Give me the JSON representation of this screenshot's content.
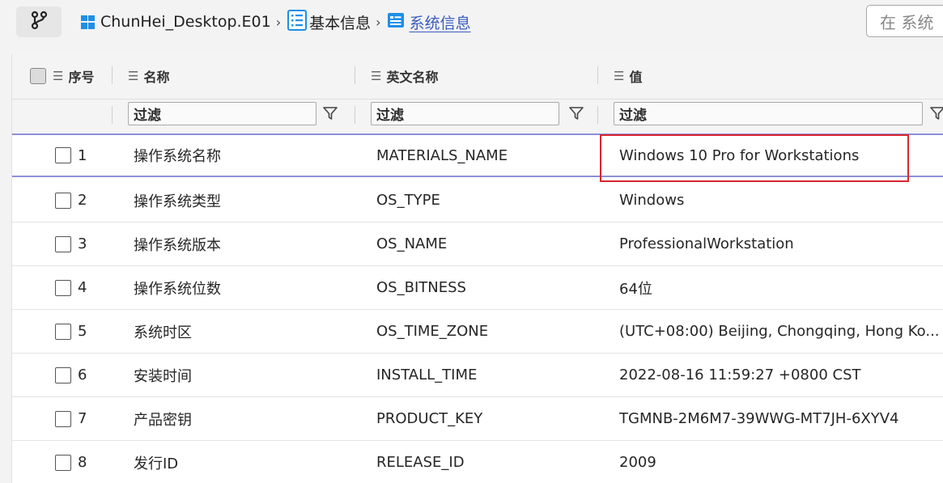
{
  "breadcrumb": {
    "machine": "ChunHei_Desktop.E01",
    "category": "基本信息",
    "current": "系统信息",
    "separator": "›"
  },
  "search": {
    "placeholder": "在 系统"
  },
  "columns": {
    "index": "序号",
    "name": "名称",
    "english_name": "英文名称",
    "value": "值"
  },
  "filters": {
    "name": "过滤",
    "english_name": "过滤",
    "value": "过滤"
  },
  "rows": [
    {
      "index": "1",
      "name": "操作系统名称",
      "english_name": "MATERIALS_NAME",
      "value": "Windows 10 Pro for Workstations"
    },
    {
      "index": "2",
      "name": "操作系统类型",
      "english_name": "OS_TYPE",
      "value": "Windows"
    },
    {
      "index": "3",
      "name": "操作系统版本",
      "english_name": "OS_NAME",
      "value": "ProfessionalWorkstation"
    },
    {
      "index": "4",
      "name": "操作系统位数",
      "english_name": "OS_BITNESS",
      "value": "64位"
    },
    {
      "index": "5",
      "name": "系统时区",
      "english_name": "OS_TIME_ZONE",
      "value": "(UTC+08:00) Beijing, Chongqing, Hong Ko..."
    },
    {
      "index": "6",
      "name": "安装时间",
      "english_name": "INSTALL_TIME",
      "value": "2022-08-16 11:59:27 +0800 CST"
    },
    {
      "index": "7",
      "name": "产品密钥",
      "english_name": "PRODUCT_KEY",
      "value": "TGMNB-2M6M7-39WWG-MT7JH-6XYV4"
    },
    {
      "index": "8",
      "name": "发行ID",
      "english_name": "RELEASE_ID",
      "value": "2009"
    }
  ],
  "colors": {
    "accent": "#3a5bbf",
    "windows_blue": "#1e8fe6",
    "highlight_border": "#d9262f",
    "selected_row_border": "#8d8fd8"
  }
}
